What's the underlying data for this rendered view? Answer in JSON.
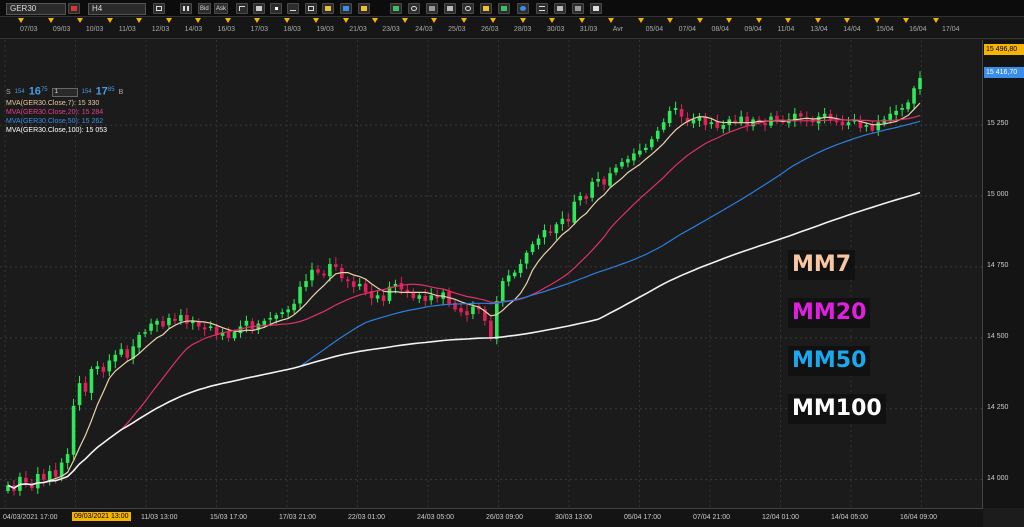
{
  "toolbar": {
    "symbol": "GER30",
    "timeframe": "H4",
    "bid_label": "Bid",
    "ask_label": "Ask"
  },
  "date_strip": {
    "ticks": [
      "07/03",
      "09/03",
      "10/03",
      "11/03",
      "12/03",
      "14/03",
      "16/03",
      "17/03",
      "18/03",
      "19/03",
      "21/03",
      "23/03",
      "24/03",
      "25/03",
      "26/03",
      "28/03",
      "30/03",
      "31/03",
      "Avr",
      "05/04",
      "07/04",
      "08/04",
      "09/04",
      "11/04",
      "13/04",
      "14/04",
      "15/04",
      "16/04",
      "17/04"
    ]
  },
  "info": {
    "s_label": "S",
    "bid_small": "154",
    "bid_big": "16",
    "bid_sup": "75",
    "lot": "1",
    "ask_small": "154",
    "ask_big": "17",
    "ask_sup": "85",
    "b_label": "B",
    "indicators": [
      {
        "text": "MVA(GER30.Close,7): 15 330",
        "color": "#e8c9a0"
      },
      {
        "text": "MVA(GER30.Close,20): 15 284",
        "color": "#e0408a"
      },
      {
        "text": "MVA(GER30.Close,50): 15 262",
        "color": "#3a8de8"
      },
      {
        "text": "MVA(GER30.Close,100): 15 053",
        "color": "#ffffff"
      }
    ]
  },
  "price_axis": {
    "ticks": [
      "15 250",
      "15 000",
      "14 750",
      "14 500",
      "14 250",
      "14 000"
    ],
    "tag_high": "15 496,80",
    "tag_last": "15 416,70"
  },
  "time_axis": {
    "ticks": [
      "04/03/2021 17:00",
      "09/03/2021 13:00",
      "11/03 13:00",
      "15/03 17:00",
      "17/03 21:00",
      "22/03 01:00",
      "24/03 05:00",
      "26/03 09:00",
      "30/03 13:00",
      "05/04 17:00",
      "07/04 21:00",
      "12/04 01:00",
      "14/04 05:00",
      "16/04 09:00"
    ],
    "highlight": "09/03/2021 13:00"
  },
  "legend": [
    {
      "label": "MM7",
      "color": "#f7c7a3"
    },
    {
      "label": "MM20",
      "color": "#e020e0"
    },
    {
      "label": "MM50",
      "color": "#1aa8f0"
    },
    {
      "label": "MM100",
      "color": "#ffffff"
    }
  ],
  "colors": {
    "bull": "#2ee85a",
    "bear": "#e0205a",
    "ma7": "#e8d4a8",
    "ma20": "#e0306a",
    "ma50": "#2a7fe0",
    "ma100": "#f2f2f2",
    "marker": "#f4b400",
    "tag_high": "#f4b400",
    "tag_last": "#3a8de8"
  },
  "chart_data": {
    "type": "candlestick",
    "ylim": [
      13900,
      15550
    ],
    "y_ticks": [
      14000,
      14250,
      14500,
      14750,
      15000,
      15250
    ],
    "closes": [
      13980,
      13960,
      14010,
      13990,
      13970,
      14020,
      14000,
      14030,
      14010,
      14060,
      14090,
      14260,
      14340,
      14310,
      14390,
      14400,
      14380,
      14420,
      14440,
      14460,
      14430,
      14470,
      14510,
      14520,
      14550,
      14560,
      14540,
      14570,
      14560,
      14580,
      14550,
      14560,
      14540,
      14530,
      14540,
      14510,
      14520,
      14500,
      14520,
      14540,
      14560,
      14530,
      14550,
      14560,
      14570,
      14580,
      14590,
      14600,
      14620,
      14680,
      14700,
      14740,
      14730,
      14720,
      14760,
      14750,
      14710,
      14700,
      14680,
      14690,
      14660,
      14640,
      14650,
      14630,
      14680,
      14690,
      14670,
      14660,
      14640,
      14650,
      14630,
      14650,
      14640,
      14660,
      14620,
      14600,
      14590,
      14580,
      14610,
      14600,
      14560,
      14500,
      14630,
      14700,
      14720,
      14730,
      14760,
      14800,
      14830,
      14850,
      14880,
      14870,
      14900,
      14920,
      14910,
      14980,
      15000,
      14990,
      15050,
      15060,
      15040,
      15080,
      15100,
      15120,
      15130,
      15150,
      15160,
      15170,
      15200,
      15230,
      15260,
      15300,
      15310,
      15280,
      15260,
      15270,
      15280,
      15250,
      15260,
      15240,
      15250,
      15270,
      15260,
      15280,
      15250,
      15270,
      15260,
      15250,
      15280,
      15270,
      15260,
      15270,
      15290,
      15280,
      15270,
      15260,
      15280,
      15290,
      15270,
      15260,
      15250,
      15260,
      15270,
      15240,
      15250,
      15230,
      15260,
      15270,
      15290,
      15300,
      15310,
      15330,
      15380,
      15416
    ]
  }
}
